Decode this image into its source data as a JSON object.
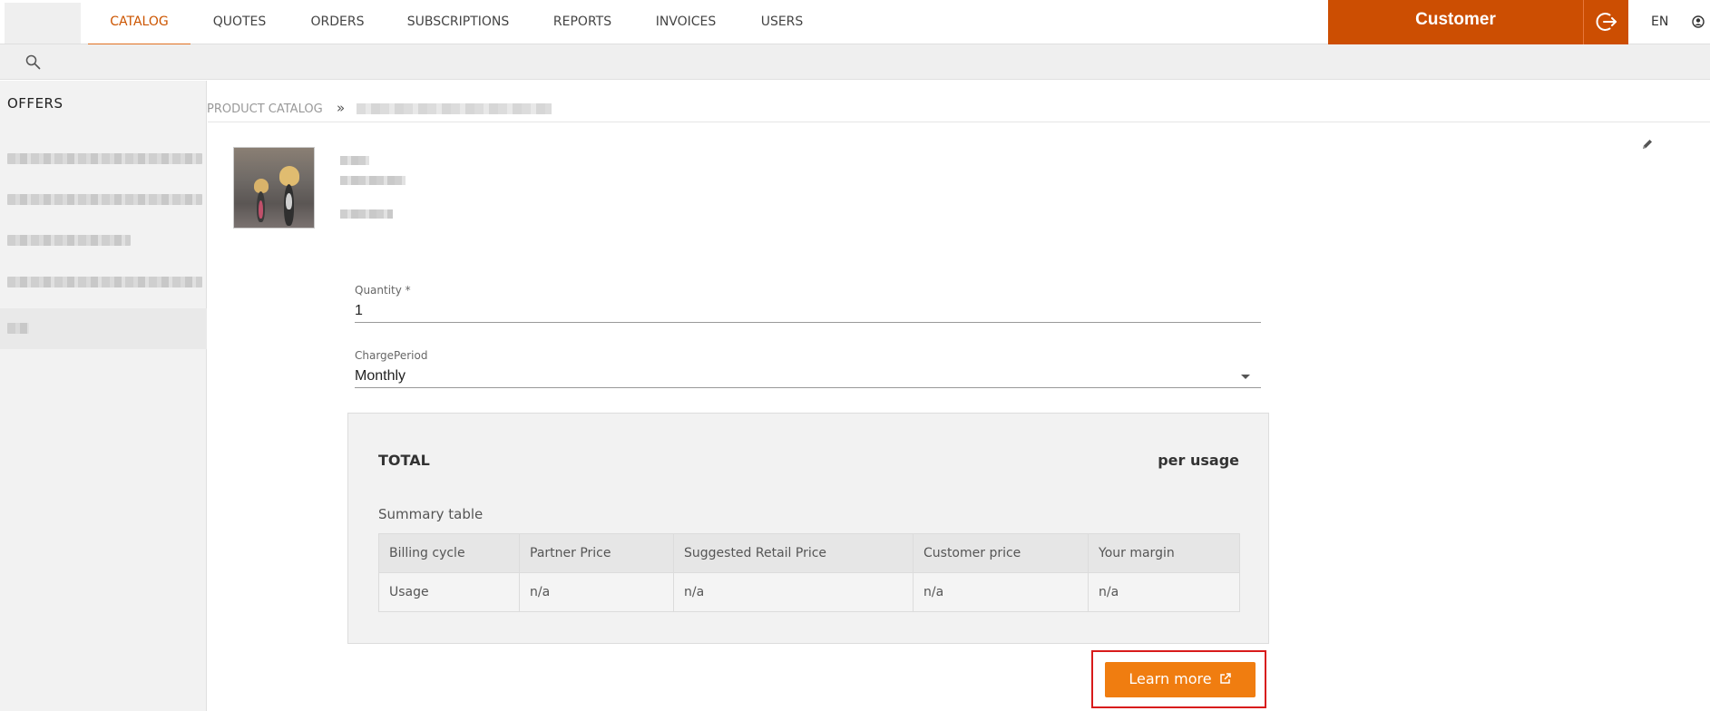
{
  "nav": {
    "tabs": [
      {
        "label": "CATALOG",
        "active": true
      },
      {
        "label": "QUOTES",
        "active": false
      },
      {
        "label": "ORDERS",
        "active": false
      },
      {
        "label": "SUBSCRIPTIONS",
        "active": false
      },
      {
        "label": "REPORTS",
        "active": false
      },
      {
        "label": "INVOICES",
        "active": false
      },
      {
        "label": "USERS",
        "active": false
      }
    ],
    "customer_label": "Customer",
    "language": "EN",
    "logout_icon": "logout-icon",
    "user_icon": "user-icon"
  },
  "search": {
    "icon": "search-icon"
  },
  "sidebar": {
    "title": "OFFERS",
    "items": [
      {
        "label": ""
      },
      {
        "label": ""
      },
      {
        "label": ""
      },
      {
        "label": ""
      },
      {
        "label": "",
        "selected": true
      }
    ]
  },
  "breadcrumb": {
    "root": "PRODUCT CATALOG",
    "separator": "»",
    "current": ""
  },
  "product": {
    "edit_icon": "pencil-icon"
  },
  "form": {
    "quantity_label": "Quantity *",
    "quantity_value": "1",
    "charge_period_label": "ChargePeriod",
    "charge_period_value": "Monthly"
  },
  "total": {
    "label": "TOTAL",
    "value": "per usage",
    "summary_title": "Summary table",
    "columns": [
      "Billing cycle",
      "Partner Price",
      "Suggested Retail Price",
      "Customer price",
      "Your margin"
    ],
    "rows": [
      [
        "Usage",
        "n/a",
        "n/a",
        "n/a",
        "n/a"
      ]
    ]
  },
  "actions": {
    "learn_more_label": "Learn more"
  },
  "colors": {
    "accent_orange": "#cc4e02",
    "button_orange": "#f07d10",
    "highlight_red": "#d81b1b"
  }
}
